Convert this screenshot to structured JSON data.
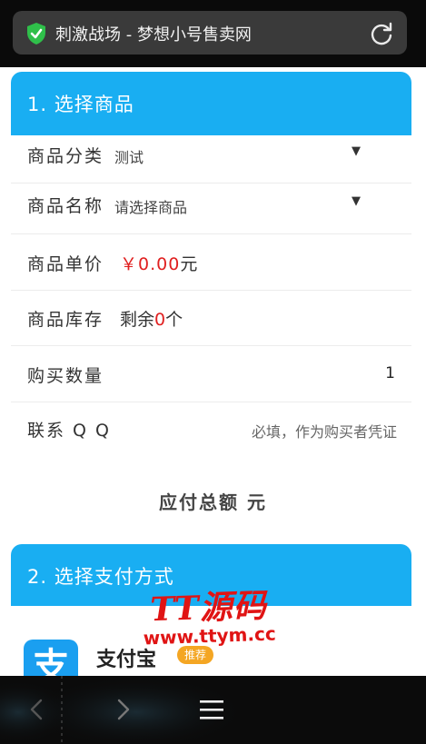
{
  "browser": {
    "title": "刺激战场 - 梦想小号售卖网",
    "shield_icon": "security-shield-icon",
    "refresh_icon": "refresh-icon"
  },
  "section1": {
    "title": "1. 选择商品",
    "category": {
      "label": "商品分类",
      "value": "测试"
    },
    "product": {
      "label": "商品名称",
      "placeholder": "请选择商品"
    },
    "price": {
      "label": "商品单价",
      "value": "￥0.00",
      "unit": "元"
    },
    "stock": {
      "label": "商品库存",
      "prefix": "剩余",
      "count": "0",
      "suffix": "个"
    },
    "quantity": {
      "label": "购买数量",
      "value": "1"
    },
    "qq": {
      "label": "联系 Q Q",
      "placeholder": "必填，作为购买者凭证"
    },
    "total": "应付总额 元"
  },
  "section2": {
    "title": "2. 选择支付方式",
    "alipay": {
      "name": "支付宝",
      "badge": "推荐",
      "icon_char": "支"
    }
  },
  "watermark": {
    "line1": "TT源码",
    "line2": "www.ttym.cc"
  },
  "colors": {
    "accent": "#19aef2",
    "price": "#e02020",
    "badge": "#f4a623"
  }
}
